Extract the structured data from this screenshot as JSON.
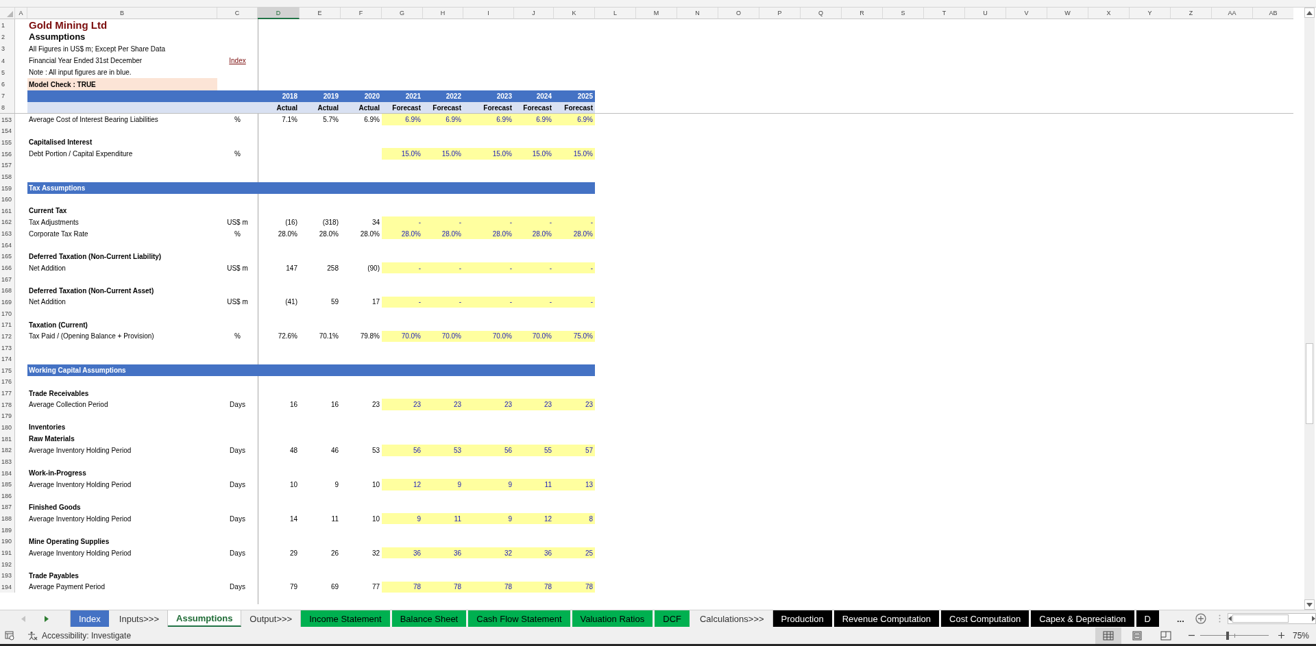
{
  "column_headers": [
    {
      "label": "A",
      "selected": false
    },
    {
      "label": "B",
      "selected": false
    },
    {
      "label": "C",
      "selected": false
    },
    {
      "label": "D",
      "selected": true
    },
    {
      "label": "E",
      "selected": false
    },
    {
      "label": "F",
      "selected": false
    },
    {
      "label": "G",
      "selected": false
    },
    {
      "label": "H",
      "selected": false
    },
    {
      "label": "I",
      "selected": false
    },
    {
      "label": "J",
      "selected": false
    },
    {
      "label": "K",
      "selected": false
    },
    {
      "label": "L",
      "selected": false
    },
    {
      "label": "M",
      "selected": false
    },
    {
      "label": "N",
      "selected": false
    },
    {
      "label": "O",
      "selected": false
    },
    {
      "label": "P",
      "selected": false
    },
    {
      "label": "Q",
      "selected": false
    },
    {
      "label": "R",
      "selected": false
    },
    {
      "label": "S",
      "selected": false
    },
    {
      "label": "T",
      "selected": false
    },
    {
      "label": "U",
      "selected": false
    },
    {
      "label": "V",
      "selected": false
    },
    {
      "label": "W",
      "selected": false
    },
    {
      "label": "X",
      "selected": false
    },
    {
      "label": "Y",
      "selected": false
    },
    {
      "label": "Z",
      "selected": false
    },
    {
      "label": "AA",
      "selected": false
    },
    {
      "label": "AB",
      "selected": false
    }
  ],
  "header": {
    "row_numbers": [
      "1",
      "2",
      "3",
      "4",
      "5",
      "6",
      "7",
      "8"
    ],
    "title": "Gold Mining Ltd",
    "subtitle": "Assumptions",
    "notes": [
      "All Figures in US$ m; Except Per Share Data",
      "Financial Year Ended 31st December",
      "Note :  All input figures are in blue."
    ],
    "index_link": "Index",
    "model_check": "Model Check : TRUE",
    "years": [
      {
        "year": "2018",
        "basis": "Actual"
      },
      {
        "year": "2019",
        "basis": "Actual"
      },
      {
        "year": "2020",
        "basis": "Actual"
      },
      {
        "year": "2021",
        "basis": "Forecast"
      },
      {
        "year": "2022",
        "basis": "Forecast"
      },
      {
        "year": "2023",
        "basis": "Forecast"
      },
      {
        "year": "2024",
        "basis": "Forecast"
      },
      {
        "year": "2025",
        "basis": "Forecast"
      }
    ]
  },
  "rows": [
    {
      "row": "153",
      "kind": "data",
      "label": "Average Cost of Interest Bearing Liabilities",
      "unit": "%",
      "actuals": [
        "7.1%",
        "5.7%",
        "6.9%"
      ],
      "forecasts": [
        "6.9%",
        "6.9%",
        "6.9%",
        "6.9%",
        "6.9%"
      ]
    },
    {
      "row": "154",
      "kind": "blank"
    },
    {
      "row": "155",
      "kind": "heading",
      "label": "Capitalised Interest"
    },
    {
      "row": "156",
      "kind": "data",
      "label": "Debt Portion / Capital Expenditure",
      "unit": "%",
      "forecasts": [
        "15.0%",
        "15.0%",
        "15.0%",
        "15.0%",
        "15.0%"
      ]
    },
    {
      "row": "157",
      "kind": "blank"
    },
    {
      "row": "158",
      "kind": "blank"
    },
    {
      "row": "159",
      "kind": "section",
      "label": "Tax Assumptions"
    },
    {
      "row": "160",
      "kind": "blank"
    },
    {
      "row": "161",
      "kind": "heading",
      "label": "Current Tax"
    },
    {
      "row": "162",
      "kind": "data",
      "label": "Tax Adjustments",
      "unit": "US$ m",
      "actuals": [
        "(16)",
        "(318)",
        "34"
      ],
      "forecasts": [
        "-",
        "-",
        "-",
        "-",
        "-"
      ]
    },
    {
      "row": "163",
      "kind": "data",
      "label": "Corporate Tax Rate",
      "unit": "%",
      "actuals": [
        "28.0%",
        "28.0%",
        "28.0%"
      ],
      "forecasts": [
        "28.0%",
        "28.0%",
        "28.0%",
        "28.0%",
        "28.0%"
      ]
    },
    {
      "row": "164",
      "kind": "blank"
    },
    {
      "row": "165",
      "kind": "heading",
      "label": "Deferred Taxation (Non-Current Liability)"
    },
    {
      "row": "166",
      "kind": "data",
      "label": "Net Addition",
      "unit": "US$ m",
      "actuals": [
        "147",
        "258",
        "(90)"
      ],
      "forecasts": [
        "-",
        "-",
        "-",
        "-",
        "-"
      ]
    },
    {
      "row": "167",
      "kind": "blank"
    },
    {
      "row": "168",
      "kind": "heading",
      "label": "Deferred Taxation (Non-Current Asset)"
    },
    {
      "row": "169",
      "kind": "data",
      "label": "Net Addition",
      "unit": "US$ m",
      "actuals": [
        "(41)",
        "59",
        "17"
      ],
      "forecasts": [
        "-",
        "-",
        "-",
        "-",
        "-"
      ]
    },
    {
      "row": "170",
      "kind": "blank"
    },
    {
      "row": "171",
      "kind": "heading",
      "label": "Taxation (Current)"
    },
    {
      "row": "172",
      "kind": "data",
      "label": "Tax Paid / (Opening Balance + Provision)",
      "unit": "%",
      "actuals": [
        "72.6%",
        "70.1%",
        "79.8%"
      ],
      "forecasts": [
        "70.0%",
        "70.0%",
        "70.0%",
        "70.0%",
        "75.0%"
      ]
    },
    {
      "row": "173",
      "kind": "blank"
    },
    {
      "row": "174",
      "kind": "blank"
    },
    {
      "row": "175",
      "kind": "section",
      "label": "Working Capital Assumptions"
    },
    {
      "row": "176",
      "kind": "blank"
    },
    {
      "row": "177",
      "kind": "heading",
      "label": "Trade Receivables"
    },
    {
      "row": "178",
      "kind": "data",
      "label": "Average Collection Period",
      "unit": "Days",
      "actuals": [
        "16",
        "16",
        "23"
      ],
      "forecasts": [
        "23",
        "23",
        "23",
        "23",
        "23"
      ]
    },
    {
      "row": "179",
      "kind": "blank"
    },
    {
      "row": "180",
      "kind": "heading",
      "label": "Inventories"
    },
    {
      "row": "181",
      "kind": "heading",
      "label": "Raw Materials"
    },
    {
      "row": "182",
      "kind": "data",
      "label": "Average Inventory Holding Period",
      "unit": "Days",
      "actuals": [
        "48",
        "46",
        "53"
      ],
      "forecasts": [
        "56",
        "53",
        "56",
        "55",
        "57"
      ]
    },
    {
      "row": "183",
      "kind": "blank"
    },
    {
      "row": "184",
      "kind": "heading",
      "label": "Work-in-Progress"
    },
    {
      "row": "185",
      "kind": "data",
      "label": "Average Inventory Holding Period",
      "unit": "Days",
      "actuals": [
        "10",
        "9",
        "10"
      ],
      "forecasts": [
        "12",
        "9",
        "9",
        "11",
        "13"
      ]
    },
    {
      "row": "186",
      "kind": "blank"
    },
    {
      "row": "187",
      "kind": "heading",
      "label": "Finished Goods"
    },
    {
      "row": "188",
      "kind": "data",
      "label": "Average Inventory Holding Period",
      "unit": "Days",
      "actuals": [
        "14",
        "11",
        "10"
      ],
      "forecasts": [
        "9",
        "11",
        "9",
        "12",
        "8"
      ]
    },
    {
      "row": "189",
      "kind": "blank"
    },
    {
      "row": "190",
      "kind": "heading",
      "label": "Mine Operating Supplies"
    },
    {
      "row": "191",
      "kind": "data",
      "label": "Average Inventory Holding Period",
      "unit": "Days",
      "actuals": [
        "29",
        "26",
        "32"
      ],
      "forecasts": [
        "36",
        "36",
        "32",
        "36",
        "25"
      ]
    },
    {
      "row": "192",
      "kind": "blank"
    },
    {
      "row": "193",
      "kind": "heading",
      "label": "Trade Payables"
    },
    {
      "row": "194",
      "kind": "data",
      "label": "Average Payment Period",
      "unit": "Days",
      "actuals": [
        "79",
        "69",
        "77"
      ],
      "forecasts": [
        "78",
        "78",
        "78",
        "78",
        "78"
      ]
    }
  ],
  "sheet_tabs": [
    {
      "label": "Index",
      "selected": false,
      "color": "#4472c4"
    },
    {
      "label": "Inputs>>>",
      "selected": false
    },
    {
      "label": "Assumptions",
      "selected": true
    },
    {
      "label": "Output>>>",
      "selected": false
    },
    {
      "label": "Income Statement",
      "selected": false,
      "color": "#00b050"
    },
    {
      "label": "Balance Sheet",
      "selected": false,
      "color": "#00b050"
    },
    {
      "label": "Cash Flow Statement",
      "selected": false,
      "color": "#00b050"
    },
    {
      "label": "Valuation Ratios",
      "selected": false,
      "color": "#00b050"
    },
    {
      "label": "DCF",
      "selected": false,
      "color": "#00b050"
    },
    {
      "label": "Calculations>>>",
      "selected": false
    },
    {
      "label": "Production",
      "selected": false,
      "color": "#000000"
    },
    {
      "label": "Revenue Computation",
      "selected": false,
      "color": "#000000"
    },
    {
      "label": "Cost Computation",
      "selected": false,
      "color": "#000000"
    },
    {
      "label": "Capex & Depreciation",
      "selected": false,
      "color": "#000000"
    },
    {
      "label": "D",
      "selected": false,
      "color": "#000000"
    }
  ],
  "tab_overflow": "...",
  "status_bar": {
    "accessibility": "Accessibility: Investigate",
    "views": [
      {
        "kind": "normal",
        "selected": true
      },
      {
        "kind": "page-layout",
        "selected": false
      },
      {
        "kind": "page-break",
        "selected": false
      }
    ],
    "zoom": {
      "level": 0.4,
      "reading": "75%"
    }
  }
}
